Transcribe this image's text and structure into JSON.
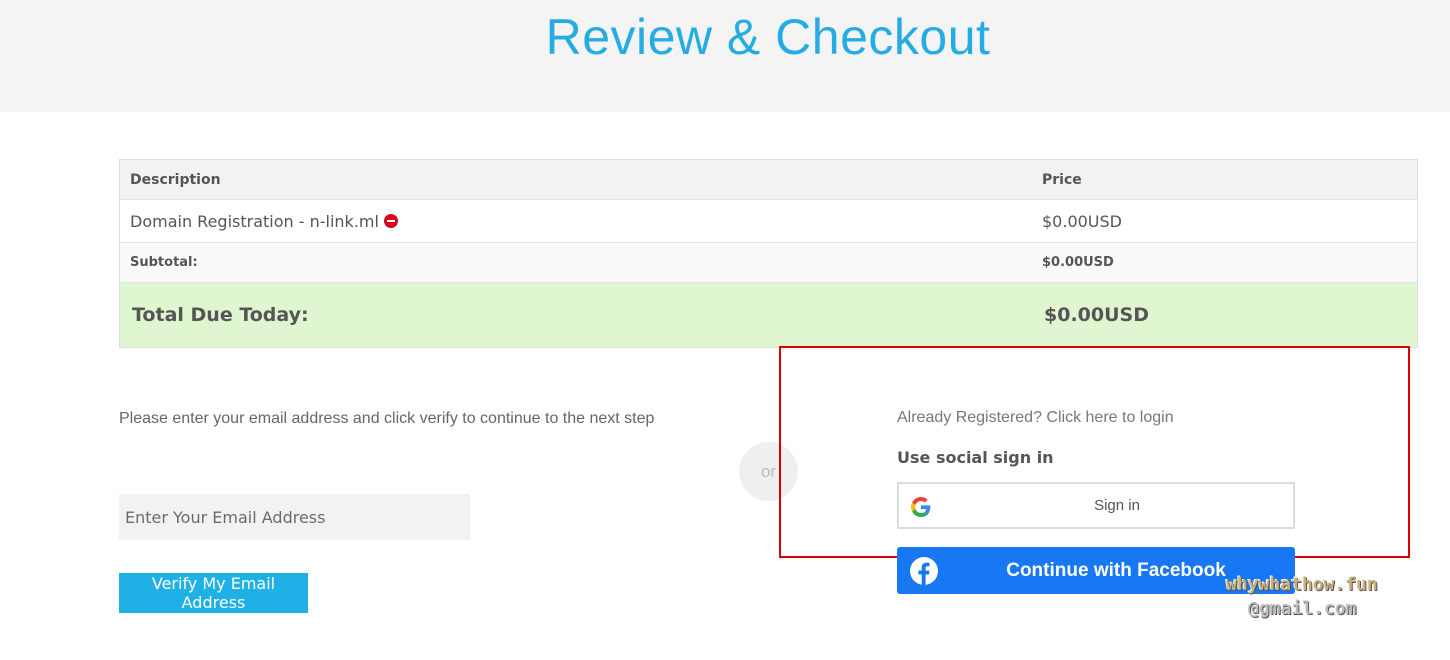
{
  "header": {
    "title": "Review & Checkout"
  },
  "cart": {
    "columns": {
      "description": "Description",
      "price": "Price"
    },
    "items": [
      {
        "description": "Domain Registration - n-link.ml",
        "price": "$0.00USD"
      }
    ],
    "subtotal": {
      "label": "Subtotal:",
      "value": "$0.00USD"
    },
    "total": {
      "label": "Total Due Today:",
      "value": "$0.00USD"
    },
    "colors": {
      "total_bg": "#dff6d0",
      "remove_icon": "#d9001b"
    }
  },
  "email_verify": {
    "intro": "Please enter your email address and click verify to continue to the next step",
    "placeholder": "Enter Your Email Address",
    "button_label": "Verify My Email Address",
    "button_color": "#1fb1e6"
  },
  "divider": {
    "or_label": "or"
  },
  "login": {
    "link_text": "Already Registered? Click here to login",
    "social_title": "Use social sign in",
    "google_label": "Sign in",
    "facebook_label": "Continue with Facebook",
    "facebook_color": "#1877f2"
  },
  "watermark": {
    "line1": "whywhathow.fun",
    "line2": "@gmail.com"
  },
  "icons": {
    "google": "google-g-icon",
    "facebook": "facebook-f-icon",
    "remove": "remove-icon"
  }
}
